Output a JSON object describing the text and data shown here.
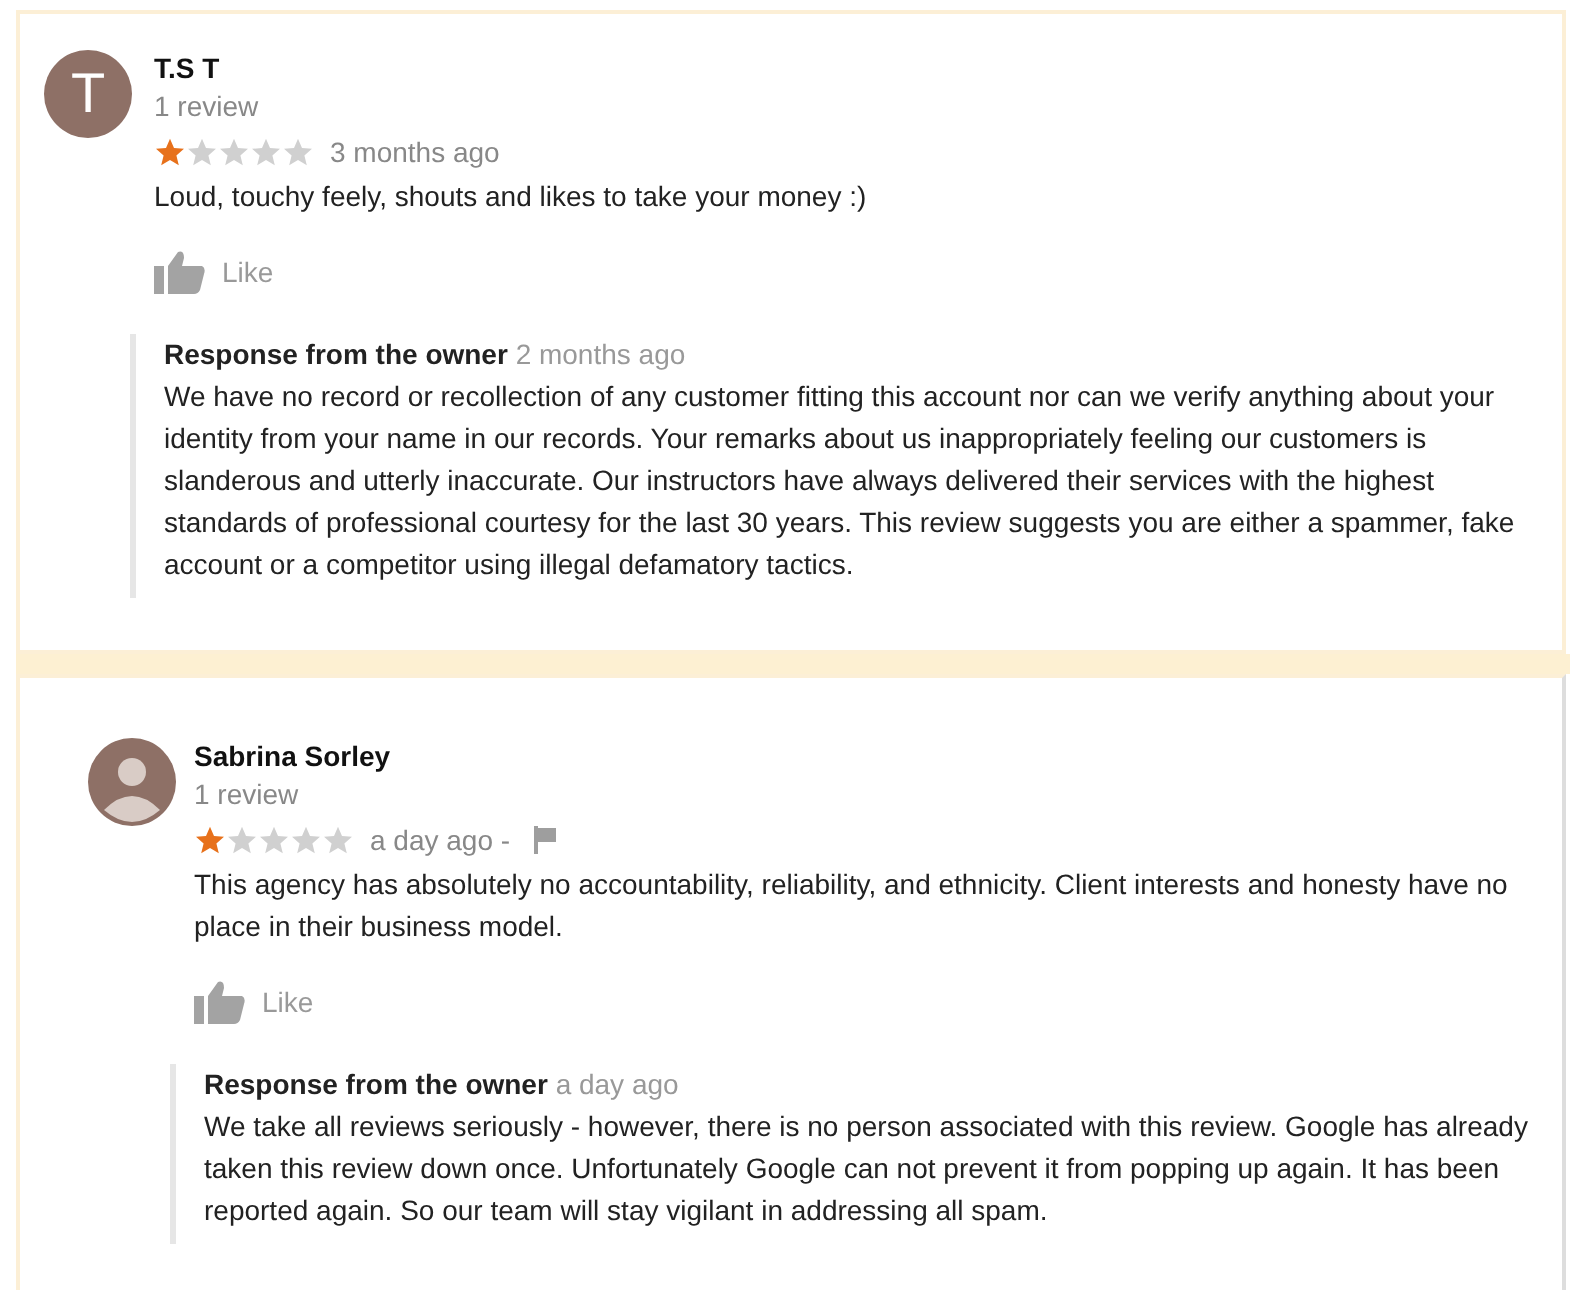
{
  "reviews": [
    {
      "author": "T.S T",
      "avatar": {
        "kind": "letter",
        "letter": "T"
      },
      "review_count": "1 review",
      "stars": 1,
      "time": "3 months ago",
      "flagged": false,
      "text": "Loud, touchy feely, shouts and likes to take your money :)",
      "like_label": "Like",
      "response": {
        "heading": "Response from the owner",
        "time": "2 months ago",
        "text": "We have no record or recollection of any customer fitting this account nor can we verify anything about your identity from your name in our records. Your remarks about us inappropriately feeling our customers is slanderous and utterly inaccurate. Our instructors have always delivered their services with the highest standards of professional courtesy for the last 30 years. This review suggests you are either a spammer, fake account or a competitor using illegal defamatory tactics."
      }
    },
    {
      "author": "Sabrina Sorley",
      "avatar": {
        "kind": "silhouette"
      },
      "review_count": "1 review",
      "stars": 1,
      "time": "a day ago -",
      "flagged": true,
      "text": "This agency has absolutely no accountability, reliability, and ethnicity. Client interests and honesty have no place in their business model.",
      "like_label": "Like",
      "response": {
        "heading": "Response from the owner",
        "time": "a day ago",
        "text": "We take all reviews seriously - however, there is no person associated with this review. Google has already taken this review down once. Unfortunately Google can not prevent it from popping up again. It has been reported again. So our team will stay vigilant in addressing all spam."
      }
    }
  ]
}
